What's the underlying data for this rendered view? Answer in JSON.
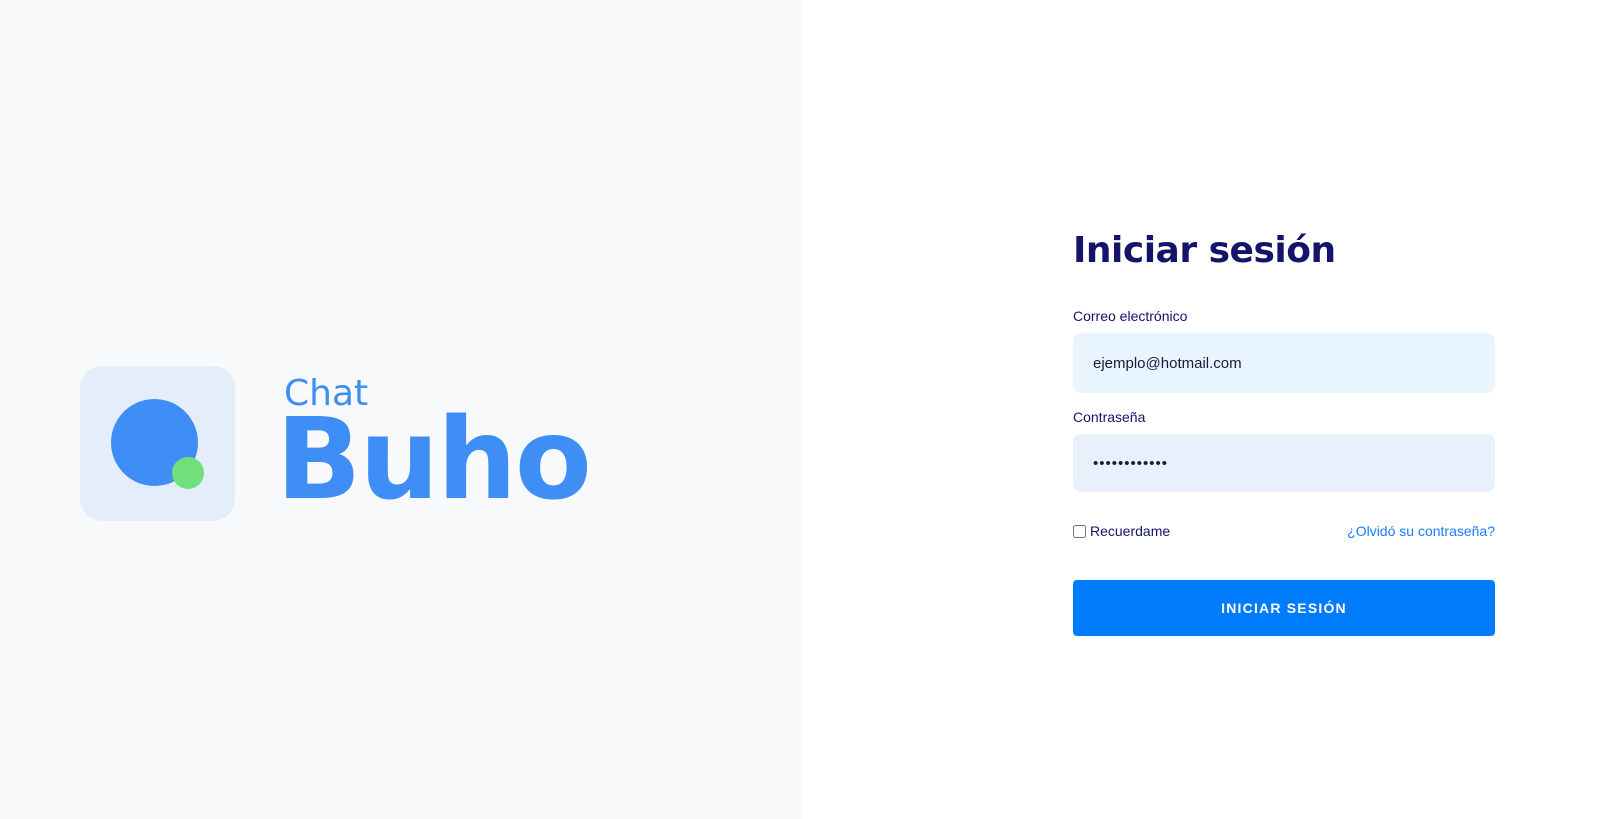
{
  "brand": {
    "line1": "Chat",
    "line2": "Buho",
    "colors": {
      "primary": "#3f8ef5",
      "accent": "#6fe07a",
      "tile": "#e4eefb"
    }
  },
  "login": {
    "title": "Iniciar sesión",
    "email": {
      "label": "Correo electrónico",
      "value": "ejemplo@hotmail.com"
    },
    "password": {
      "label": "Contraseña",
      "value": "contraseña12"
    },
    "remember_label": "Recuerdame",
    "remember_checked": false,
    "forgot_label": "¿Olvidó su contraseña?",
    "submit_label": "INICIAR SESIÓN",
    "colors": {
      "title": "#14146b",
      "button": "#007bf9",
      "link": "#1a7cf5"
    }
  }
}
